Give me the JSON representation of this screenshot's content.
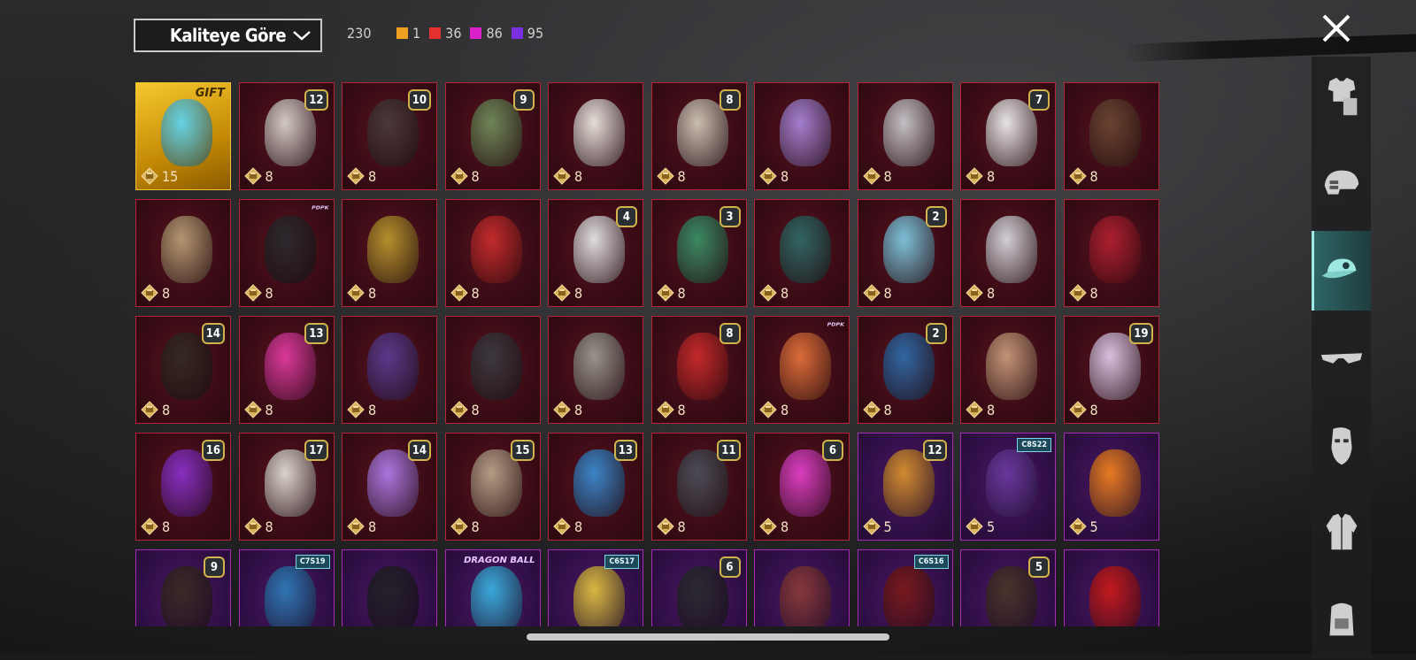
{
  "filter": {
    "sort_label": "Kaliteye Göre"
  },
  "totals": {
    "total": "230",
    "quality_counts": [
      {
        "color": "#f0a020",
        "count": "1"
      },
      {
        "color": "#e53030",
        "count": "36"
      },
      {
        "color": "#d820c8",
        "count": "86"
      },
      {
        "color": "#7a30e0",
        "count": "95"
      }
    ]
  },
  "items": [
    {
      "rarity": "gold",
      "color": "#5fd4ee",
      "tag": "gift",
      "tag_text": "GIFT",
      "cost": "15"
    },
    {
      "rarity": "red",
      "color": "#d8d2cc",
      "tag": "level",
      "tag_text": "12",
      "cost": "8"
    },
    {
      "rarity": "red",
      "color": "#4a3a3a",
      "tag": "level",
      "tag_text": "10",
      "cost": "8"
    },
    {
      "rarity": "red",
      "color": "#6f8c5a",
      "tag": "level",
      "tag_text": "9",
      "cost": "8"
    },
    {
      "rarity": "red",
      "color": "#ece8e2",
      "tag": "",
      "tag_text": "",
      "cost": "8"
    },
    {
      "rarity": "red",
      "color": "#cfc6b7",
      "tag": "level",
      "tag_text": "8",
      "cost": "8"
    },
    {
      "rarity": "red",
      "color": "#a884d8",
      "tag": "",
      "tag_text": "",
      "cost": "8"
    },
    {
      "rarity": "red",
      "color": "#c8c8cc",
      "tag": "",
      "tag_text": "",
      "cost": "8"
    },
    {
      "rarity": "red",
      "color": "#eeeeee",
      "tag": "level",
      "tag_text": "7",
      "cost": "8"
    },
    {
      "rarity": "red",
      "color": "#6a4632",
      "tag": "",
      "tag_text": "",
      "cost": "8"
    },
    {
      "rarity": "red",
      "color": "#b89d74",
      "tag": "",
      "tag_text": "",
      "cost": "8"
    },
    {
      "rarity": "red",
      "color": "#2a2a2e",
      "tag": "logo",
      "tag_text": "ᴾᴰᴾᴷ",
      "cost": "8"
    },
    {
      "rarity": "red",
      "color": "#b8962e",
      "tag": "",
      "tag_text": "",
      "cost": "8"
    },
    {
      "rarity": "red",
      "color": "#c72c2c",
      "tag": "",
      "tag_text": "",
      "cost": "8"
    },
    {
      "rarity": "red",
      "color": "#e6e6e6",
      "tag": "level",
      "tag_text": "4",
      "cost": "8"
    },
    {
      "rarity": "red",
      "color": "#3a8f66",
      "tag": "level",
      "tag_text": "3",
      "cost": "8"
    },
    {
      "rarity": "red",
      "color": "#2e6a66",
      "tag": "",
      "tag_text": "",
      "cost": "8"
    },
    {
      "rarity": "red",
      "color": "#7fc8e0",
      "tag": "level",
      "tag_text": "2",
      "cost": "8"
    },
    {
      "rarity": "red",
      "color": "#d8d8de",
      "tag": "",
      "tag_text": "",
      "cost": "8"
    },
    {
      "rarity": "red",
      "color": "#b02030",
      "tag": "",
      "tag_text": "",
      "cost": "8"
    },
    {
      "rarity": "red",
      "color": "#332a24",
      "tag": "level",
      "tag_text": "14",
      "cost": "8"
    },
    {
      "rarity": "red",
      "color": "#e03aa0",
      "tag": "level",
      "tag_text": "13",
      "cost": "8"
    },
    {
      "rarity": "red",
      "color": "#5c3a90",
      "tag": "",
      "tag_text": "",
      "cost": "8"
    },
    {
      "rarity": "red",
      "color": "#3a3a40",
      "tag": "",
      "tag_text": "",
      "cost": "8"
    },
    {
      "rarity": "red",
      "color": "#9a9a90",
      "tag": "",
      "tag_text": "",
      "cost": "8"
    },
    {
      "rarity": "red",
      "color": "#c82a2a",
      "tag": "level",
      "tag_text": "8",
      "cost": "8"
    },
    {
      "rarity": "red",
      "color": "#e2703a",
      "tag": "logo",
      "tag_text": "ᴾᴰᴾᴷ",
      "cost": "8"
    },
    {
      "rarity": "red",
      "color": "#2e6aa8",
      "tag": "level",
      "tag_text": "2",
      "cost": "8"
    },
    {
      "rarity": "red",
      "color": "#c89a7a",
      "tag": "",
      "tag_text": "",
      "cost": "8"
    },
    {
      "rarity": "red",
      "color": "#e0c8e8",
      "tag": "level",
      "tag_text": "19",
      "cost": "8"
    },
    {
      "rarity": "red",
      "color": "#8a30c8",
      "tag": "level",
      "tag_text": "16",
      "cost": "8"
    },
    {
      "rarity": "red",
      "color": "#e0dcd4",
      "tag": "level",
      "tag_text": "17",
      "cost": "8"
    },
    {
      "rarity": "red",
      "color": "#b07ae8",
      "tag": "level",
      "tag_text": "14",
      "cost": "8"
    },
    {
      "rarity": "red",
      "color": "#b8a48a",
      "tag": "level",
      "tag_text": "15",
      "cost": "8"
    },
    {
      "rarity": "red",
      "color": "#3a8ad0",
      "tag": "level",
      "tag_text": "13",
      "cost": "8"
    },
    {
      "rarity": "red",
      "color": "#4a4e58",
      "tag": "level",
      "tag_text": "11",
      "cost": "8"
    },
    {
      "rarity": "red",
      "color": "#e040c8",
      "tag": "level",
      "tag_text": "6",
      "cost": "8"
    },
    {
      "rarity": "purple",
      "color": "#d8902e",
      "tag": "level",
      "tag_text": "12",
      "cost": "5"
    },
    {
      "rarity": "purple",
      "color": "#6a3aa0",
      "tag": "badge",
      "tag_text": "C8S22",
      "cost": "5"
    },
    {
      "rarity": "purple",
      "color": "#f08020",
      "tag": "",
      "tag_text": "",
      "cost": "5"
    },
    {
      "rarity": "purple",
      "color": "#3a2a24",
      "tag": "level",
      "tag_text": "9",
      "cost": ""
    },
    {
      "rarity": "purple",
      "color": "#2e7ab8",
      "tag": "badge",
      "tag_text": "C7S19",
      "cost": ""
    },
    {
      "rarity": "purple",
      "color": "#222226",
      "tag": "",
      "tag_text": "",
      "cost": ""
    },
    {
      "rarity": "purple",
      "color": "#3ab0e0",
      "tag": "logo",
      "tag_text": "DRAGON BALL",
      "cost": ""
    },
    {
      "rarity": "purple",
      "color": "#e0c040",
      "tag": "badge",
      "tag_text": "C6S17",
      "cost": ""
    },
    {
      "rarity": "purple",
      "color": "#2a2a2e",
      "tag": "level",
      "tag_text": "6",
      "cost": ""
    },
    {
      "rarity": "purple",
      "color": "#8a3a3a",
      "tag": "",
      "tag_text": "",
      "cost": ""
    },
    {
      "rarity": "purple",
      "color": "#7a1a1a",
      "tag": "badge",
      "tag_text": "C6S16",
      "cost": ""
    },
    {
      "rarity": "purple",
      "color": "#4a3428",
      "tag": "level",
      "tag_text": "5",
      "cost": ""
    },
    {
      "rarity": "purple",
      "color": "#c81a1a",
      "tag": "",
      "tag_text": "",
      "cost": ""
    }
  ],
  "side_tabs": [
    {
      "name": "outfit-tab",
      "icon": "outfit-icon",
      "active": false
    },
    {
      "name": "helmet-tab",
      "icon": "helmet-icon",
      "active": false
    },
    {
      "name": "headwear-tab",
      "icon": "cap-icon",
      "active": true
    },
    {
      "name": "eyewear-tab",
      "icon": "glasses-icon",
      "active": false
    },
    {
      "name": "mask-tab",
      "icon": "mask-icon",
      "active": false
    },
    {
      "name": "jacket-tab",
      "icon": "jacket-icon",
      "active": false
    },
    {
      "name": "backpack-tab",
      "icon": "backpack-icon",
      "active": false
    }
  ]
}
